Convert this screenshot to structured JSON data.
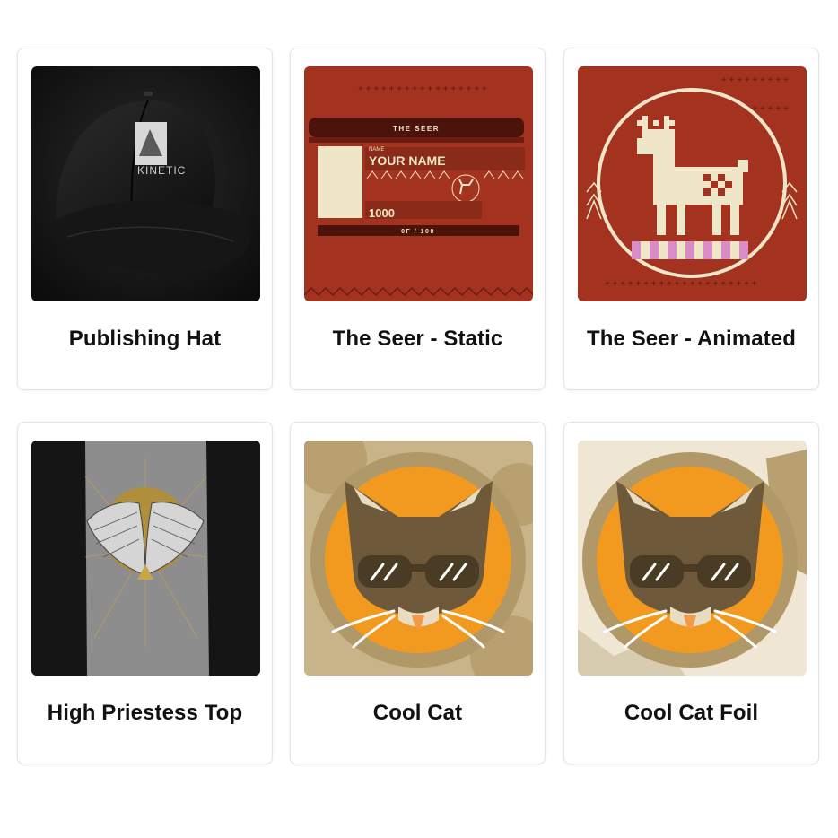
{
  "products": [
    {
      "title": "Publishing Hat",
      "icon": "baseball-cap-image",
      "hat_brand": "KINETIC"
    },
    {
      "title": "The Seer - Static",
      "icon": "nft-card-image",
      "card": {
        "header": "THE SEER",
        "name_label": "NAME",
        "name": "YOUR NAME",
        "number": "1000",
        "edition": "0F / 100"
      }
    },
    {
      "title": "The Seer - Animated",
      "icon": "pixel-deer-image"
    },
    {
      "title": "High Priestess Top",
      "icon": "winged-shirt-image"
    },
    {
      "title": "Cool Cat",
      "icon": "cool-cat-image"
    },
    {
      "title": "Cool Cat Foil",
      "icon": "cool-cat-foil-image"
    }
  ],
  "colors": {
    "card_border": "#e3e3e3",
    "seer_red": "#a3321f",
    "seer_cream": "#efe6c8",
    "cat_orange": "#f29a1f",
    "cat_brown": "#6e5a3a"
  }
}
